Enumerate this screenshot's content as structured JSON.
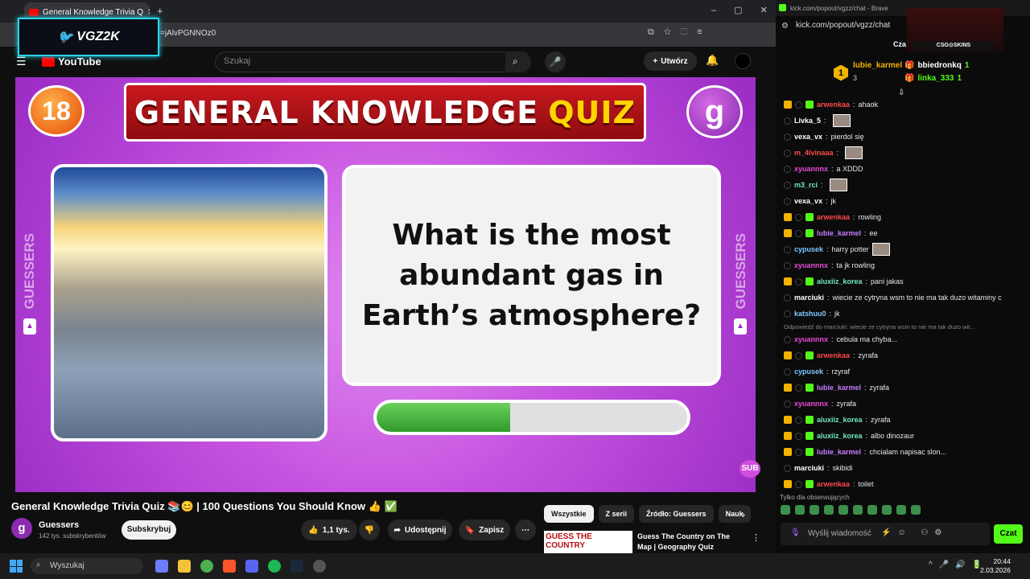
{
  "browser": {
    "tab_title": "General Knowledge Trivia Q",
    "url_fragment": "=jAlvPGNNOz0"
  },
  "overlay": {
    "logo_text": "VGZ2K"
  },
  "youtube": {
    "logo": "YouTube",
    "search_placeholder": "Szukaj",
    "create_label": "Utwórz"
  },
  "video": {
    "age_badge": "18",
    "banner_main": "GENERAL KNOWLEDGE",
    "banner_accent": "QUIZ",
    "channel_logo": "g",
    "question": "What is the most abundant gas in Earth’s atmosphere?",
    "side_label": "GUESSERS",
    "timer_progress": 0.43,
    "sub_badge": "SUB"
  },
  "below": {
    "title": "General Knowledge Trivia Quiz 📚😊 | 100 Questions You Should Know 👍 ✅",
    "channel": "Guessers",
    "subscribers": "142 tys. subskrybentów",
    "subscribe": "Subskrybuj",
    "likes": "1,1 tys.",
    "share": "Udostępnij",
    "save": "Zapisz",
    "chips": [
      "Wszystkie",
      "Z serii",
      "Źródło: Guessers",
      "Nauk"
    ],
    "rec_thumb": "GUESS THE COUNTRY",
    "rec_title": "Guess The Country on The Map | Geography Quiz Challenge"
  },
  "chat": {
    "window_title": "kick.com/popout/vgzz/chat - Brave",
    "url": "kick.com/popout/vgzz/chat",
    "cam_label": "CSG⊙SKINS",
    "tab_label": "Cza",
    "gifters": [
      {
        "rank": "1",
        "name": "lubie_karmel",
        "count": "3"
      },
      {
        "name": "bbiedronkq",
        "count": "1"
      },
      {
        "name": "linka_333",
        "count": "1"
      }
    ],
    "messages": [
      {
        "user": "arwenkaa",
        "text": "ahaok",
        "color": "#ff4a4a",
        "badges": true
      },
      {
        "user": "Livka_5",
        "text": "",
        "color": "#ffffff",
        "emote": true
      },
      {
        "user": "vexa_vx",
        "text": "pierdol się",
        "color": "#ffffff"
      },
      {
        "user": "m_4lvinaaa",
        "text": "",
        "color": "#ff4a4a",
        "emote": true
      },
      {
        "user": "xyuannnx",
        "text": "a XDDD",
        "color": "#e94bd6"
      },
      {
        "user": "m3_rci",
        "text": "",
        "color": "#74e8c0",
        "emote": true
      },
      {
        "user": "vexa_vx",
        "text": "jk",
        "color": "#ffffff"
      },
      {
        "user": "arwenkaa",
        "text": "rowling",
        "color": "#ff4a4a",
        "badges": true
      },
      {
        "user": "lubie_karmel",
        "text": "ee",
        "color": "#c77dff",
        "badges": true
      },
      {
        "user": "cypusek",
        "text": "harry potter",
        "color": "#7ec8ff",
        "emote": true
      },
      {
        "user": "xyuannnx",
        "text": "ta jk rowling",
        "color": "#e94bd6"
      },
      {
        "user": "aluxiiz_korea",
        "text": "pani jakas",
        "color": "#74e8c0",
        "badges": true
      },
      {
        "user": "marciuki",
        "text": "wiecie ze cytryna wsm to nie ma tak duzo witaminy c",
        "color": "#ffffff"
      },
      {
        "user": "katshuu0",
        "text": "jk",
        "color": "#7ec8ff"
      },
      {
        "reply": "Odpowiedź do marciuki: wiecie ze cytryna wsm to nie ma tak duzo wit..."
      },
      {
        "user": "xyuannnx",
        "text": "cebula ma chyba...",
        "color": "#e94bd6"
      },
      {
        "user": "arwenkaa",
        "text": "zyrafa",
        "color": "#ff4a4a",
        "badges": true
      },
      {
        "user": "cypusek",
        "text": "rzyraf",
        "color": "#7ec8ff"
      },
      {
        "user": "lubie_karmel",
        "text": "zyrafa",
        "color": "#c77dff",
        "badges": true
      },
      {
        "user": "xyuannnx",
        "text": "zyrafa",
        "color": "#e94bd6"
      },
      {
        "user": "aluxiiz_korea",
        "text": "zyrafa",
        "color": "#74e8c0",
        "badges": true
      },
      {
        "user": "aluxiiz_korea",
        "text": "albo dinozaur",
        "color": "#74e8c0",
        "badges": true
      },
      {
        "user": "lubie_karmel",
        "text": "chcialam napisac slon...",
        "color": "#c77dff",
        "badges": true
      },
      {
        "user": "marciuki",
        "text": "skibidi",
        "color": "#ffffff"
      },
      {
        "user": "arwenkaa",
        "text": "toilet",
        "color": "#ff4a4a",
        "badges": true
      }
    ],
    "followers_only": "Tylko dla obserwujących",
    "input_placeholder": "Wyślij wiadomość",
    "send": "Czat"
  },
  "taskbar": {
    "search": "Wyszukaj",
    "time": "20:44",
    "date": "2.03.2026"
  }
}
